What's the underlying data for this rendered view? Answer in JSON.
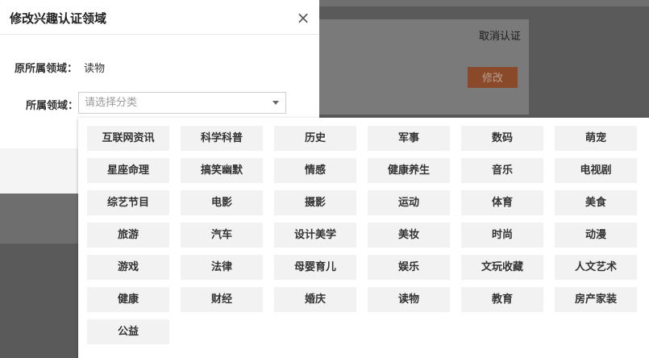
{
  "background": {
    "cancel_label": "取消认证",
    "modify_label": "修改"
  },
  "modal": {
    "title": "修改兴趣认证领域",
    "close_icon": "close-icon",
    "original_label": "原所属领域：",
    "original_value": "读物",
    "field_label": "所属领域：",
    "select_placeholder": "请选择分类"
  },
  "dropdown": {
    "rows": [
      [
        "互联网资讯",
        "科学科普",
        "历史",
        "军事",
        "数码",
        "萌宠"
      ],
      [
        "星座命理",
        "搞笑幽默",
        "情感",
        "健康养生",
        "音乐",
        "电视剧"
      ],
      [
        "综艺节目",
        "电影",
        "摄影",
        "运动",
        "体育",
        "美食"
      ],
      [
        "旅游",
        "汽车",
        "设计美学",
        "美妆",
        "时尚",
        "动漫"
      ],
      [
        "游戏",
        "法律",
        "母婴育儿",
        "娱乐",
        "文玩收藏",
        "人文艺术"
      ],
      [
        "健康",
        "财经",
        "婚庆",
        "读物",
        "教育",
        "房产家装"
      ],
      [
        "公益"
      ]
    ]
  }
}
